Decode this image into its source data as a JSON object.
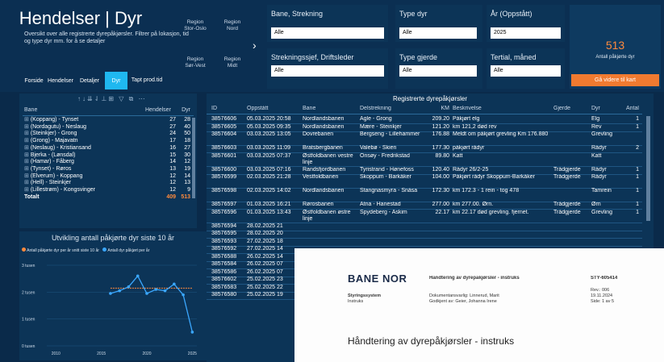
{
  "header": {
    "title": "Hendelser | Dyr",
    "subtitle": "Oversikt over alle registrerte dyrepåkjørsler. Filtrer på lokasjon, tid og type dyr mm. for å se detaljer",
    "nav": [
      "Forside",
      "Hendelser",
      "Detaljer",
      "Dyr",
      "Tapt prod.tid"
    ],
    "regions": [
      "Region Stor-Oslo",
      "Region Nord",
      "Region Sør-Vest",
      "Region Midt"
    ],
    "slicers": [
      {
        "label": "Bane, Strekning",
        "value": "Alle"
      },
      {
        "label": "Type dyr",
        "value": "Alle"
      },
      {
        "label": "År (Oppstått)",
        "value": "2025"
      },
      {
        "label": "Strekningssjef, Driftsleder",
        "value": "Alle"
      },
      {
        "label": "Type gjerde",
        "value": "Alle"
      },
      {
        "label": "Tertial, måned",
        "value": "Alle"
      }
    ],
    "kpi_value": "513",
    "kpi_label": "Antall påkjørte dyr",
    "kpi_button": "Gå videre til kart"
  },
  "left_table": {
    "headers": [
      "Bane",
      "Hendelser",
      "Dyr"
    ],
    "rows": [
      {
        "bane": "(Koppang) - Tynset",
        "h": "27",
        "d": "28"
      },
      {
        "bane": "(Nordagutu) - Neslaug",
        "h": "27",
        "d": "40"
      },
      {
        "bane": "(Steinkjer) - Grong",
        "h": "24",
        "d": "50"
      },
      {
        "bane": "(Grong) - Majavatn",
        "h": "17",
        "d": "18"
      },
      {
        "bane": "(Neslaug) - Kristiansand",
        "h": "16",
        "d": "27"
      },
      {
        "bane": "Bjerka - (Lønsdal)",
        "h": "15",
        "d": "30"
      },
      {
        "bane": "(Hamar) - Fåberg",
        "h": "14",
        "d": "12"
      },
      {
        "bane": "(Tynset) - Røros",
        "h": "13",
        "d": "19"
      },
      {
        "bane": "(Elverum) - Koppang",
        "h": "12",
        "d": "14"
      },
      {
        "bane": "(Hell) - Steinkjer",
        "h": "12",
        "d": "13"
      },
      {
        "bane": "(Lillestrøm) - Kongsvinger",
        "h": "12",
        "d": "9"
      }
    ],
    "total_label": "Totalt",
    "total_h": "409",
    "total_d": "513"
  },
  "chart": {
    "title": "Utvikling antall påkjørte dyr siste 10 år",
    "legend": [
      "Antall påkjørte dyr per år snitt siste 10 år",
      "Antall dyr påkjørt per år"
    ],
    "yticks": [
      "3 tusen",
      "2 tusen",
      "1 tusen",
      "0 tusen"
    ],
    "xticks": [
      "2010",
      "2015",
      "2020",
      "2025"
    ]
  },
  "chart_data": {
    "type": "line",
    "x": [
      2016,
      2017,
      2018,
      2019,
      2020,
      2021,
      2022,
      2023,
      2024,
      2025
    ],
    "ylim": [
      0,
      3000
    ],
    "series": [
      {
        "name": "Antall dyr påkjørt per år",
        "values": [
          1950,
          2050,
          2200,
          2600,
          1950,
          2100,
          2050,
          2300,
          1900,
          513
        ]
      },
      {
        "name": "Antall påkjørte dyr per år snitt siste 10 år",
        "values": [
          2150,
          2150,
          2150,
          2150,
          2150,
          2150,
          2150,
          2150,
          2150,
          2150
        ]
      }
    ],
    "colors": {
      "line": "#3aa7ff",
      "avg": "#ff8a3d"
    }
  },
  "right_table": {
    "title": "Registrerte dyrepåkjørsler",
    "headers": [
      "ID",
      "Oppstått",
      "Bane",
      "Delstrekning",
      "KM",
      "Beskrivelse",
      "Gjerde",
      "Dyr",
      "Antall"
    ],
    "rows": [
      {
        "id": "38576606",
        "opp": "05.03.2025 20:58",
        "bane": "Nordlandsbanen",
        "del": "Agle - Grong",
        "km": "209.20",
        "bes": "Påkjørt elg",
        "gj": "",
        "dyr": "Elg",
        "ant": "1"
      },
      {
        "id": "38576605",
        "opp": "05.03.2025 09:35",
        "bane": "Nordlandsbanen",
        "del": "Mære - Steinkjer",
        "km": "121.20",
        "bes": "km 121,2 død rev",
        "gj": "",
        "dyr": "Rev",
        "ant": "1"
      },
      {
        "id": "38576604",
        "opp": "03.03.2025 13:05",
        "bane": "Dovrebanen",
        "del": "Bergseng - Lillehammer",
        "km": "176.88",
        "bes": "Meldt om påkjørt grevling Km 176.880",
        "gj": "",
        "dyr": "Grevling",
        "ant": ""
      },
      {
        "id": "38576603",
        "opp": "03.03.2025 11:09",
        "bane": "Bratsbergbanen",
        "del": "Valebø - Skien",
        "km": "177.30",
        "bes": "påkjørt rådyr",
        "gj": "",
        "dyr": "Rådyr",
        "ant": "2"
      },
      {
        "id": "38576601",
        "opp": "03.03.2025 07:37",
        "bane": "Østfoldbanen vestre linje",
        "del": "Onsøy - Fredrikstad",
        "km": "89.80",
        "bes": "Katt",
        "gj": "",
        "dyr": "Katt",
        "ant": ""
      },
      {
        "id": "38576600",
        "opp": "03.03.2025 07:16",
        "bane": "Randsfjordbanen",
        "del": "Tyristrand - Hønefoss",
        "km": "120.40",
        "bes": "Rådyr 26/2-25",
        "gj": "Trådgjerde",
        "dyr": "Rådyr",
        "ant": "1"
      },
      {
        "id": "38576599",
        "opp": "02.03.2025 21:28",
        "bane": "Vestfoldbanen",
        "del": "Skoppum - Barkåker",
        "km": "104.00",
        "bes": "Påkjørt rådyr Skoppum-Barkåker",
        "gj": "Trådgjerde",
        "dyr": "Rådyr",
        "ant": "1"
      },
      {
        "id": "38576598",
        "opp": "02.03.2025 14:02",
        "bane": "Nordlandsbanen",
        "del": "Stangnasmyra - Snåsa",
        "km": "172.30",
        "bes": "km 172.3 - 1 rein - tog 478",
        "gj": "",
        "dyr": "Tamrein",
        "ant": "1"
      },
      {
        "id": "38576597",
        "opp": "01.03.2025 16:21",
        "bane": "Rørosbanen",
        "del": "Atna - Hanestad",
        "km": "277.00",
        "bes": "km 277.00. Ørn.",
        "gj": "Trådgjerde",
        "dyr": "Ørn",
        "ant": "1"
      },
      {
        "id": "38576596",
        "opp": "01.03.2025 13:43",
        "bane": "Østfoldbanen østre linje",
        "del": "Spydeberg - Askim",
        "km": "22.17",
        "bes": "km 22.17 død grevling. fjernet.",
        "gj": "Trådgjerde",
        "dyr": "Grevling",
        "ant": "1"
      },
      {
        "id": "38576594",
        "opp": "28.02.2025 21",
        "bane": "",
        "del": "",
        "km": "",
        "bes": "",
        "gj": "",
        "dyr": "",
        "ant": ""
      },
      {
        "id": "38576595",
        "opp": "28.02.2025 20",
        "bane": "",
        "del": "",
        "km": "",
        "bes": "",
        "gj": "",
        "dyr": "",
        "ant": ""
      },
      {
        "id": "38576593",
        "opp": "27.02.2025 18",
        "bane": "",
        "del": "",
        "km": "",
        "bes": "",
        "gj": "",
        "dyr": "",
        "ant": ""
      },
      {
        "id": "38576592",
        "opp": "27.02.2025 14",
        "bane": "",
        "del": "",
        "km": "",
        "bes": "",
        "gj": "",
        "dyr": "",
        "ant": ""
      },
      {
        "id": "38576588",
        "opp": "26.02.2025 14",
        "bane": "",
        "del": "",
        "km": "",
        "bes": "",
        "gj": "",
        "dyr": "",
        "ant": ""
      },
      {
        "id": "38576584",
        "opp": "26.02.2025 07",
        "bane": "",
        "del": "",
        "km": "",
        "bes": "",
        "gj": "",
        "dyr": "",
        "ant": ""
      },
      {
        "id": "38576586",
        "opp": "26.02.2025 07",
        "bane": "",
        "del": "",
        "km": "",
        "bes": "",
        "gj": "",
        "dyr": "",
        "ant": ""
      },
      {
        "id": "38576602",
        "opp": "25.02.2025 23",
        "bane": "",
        "del": "",
        "km": "",
        "bes": "",
        "gj": "",
        "dyr": "",
        "ant": ""
      },
      {
        "id": "38576583",
        "opp": "25.02.2025 22",
        "bane": "",
        "del": "",
        "km": "",
        "bes": "",
        "gj": "",
        "dyr": "",
        "ant": ""
      },
      {
        "id": "38576580",
        "opp": "25.02.2025 19",
        "bane": "",
        "del": "",
        "km": "",
        "bes": "",
        "gj": "",
        "dyr": "",
        "ant": ""
      }
    ]
  },
  "document": {
    "logo": "BANE NOR",
    "doc_title_small": "Håndtering av dyrepåkjørsler - instruks",
    "doc_id": "STY-605414",
    "system": "Styringssystem",
    "type": "Instruks",
    "resp": "Dokumentansvarlig: Linnerud, Marit",
    "approved": "Godkjent av: Geier, Johanna Irene",
    "rev": "Rev.: 006",
    "date": "19.11.2024",
    "page": "Side: 1 av 5",
    "heading": "Håndtering av dyrepåkjørsler - instruks"
  }
}
